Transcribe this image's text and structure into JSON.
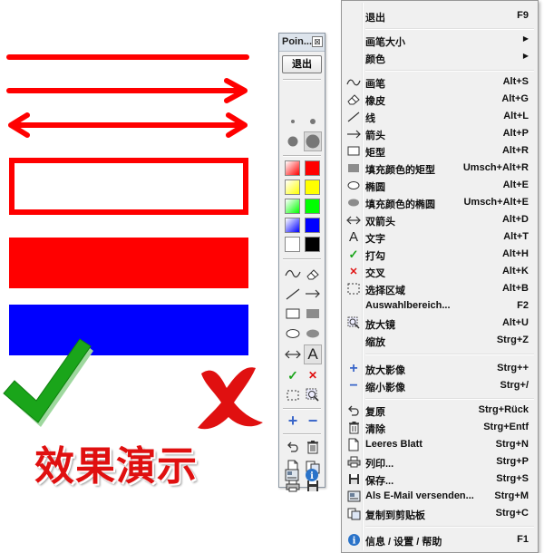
{
  "demo": {
    "title": "效果演示",
    "colors": {
      "red": "#ff0000",
      "blue": "#0000ff",
      "green": "#1aa51a",
      "cross": "#e01010"
    }
  },
  "toolbar": {
    "title": "Poin...",
    "close_glyph": "⊠",
    "exit_label": "退出",
    "text_tool_glyph": "A",
    "check_glyph": "✓",
    "cross_glyph": "✕",
    "plus_glyph": "+",
    "minus_glyph": "−",
    "info_glyph": "i",
    "colors": [
      "#ff0000",
      "#ffff00",
      "#00ff00",
      "#0000ff",
      "#000000",
      "#ffffff"
    ]
  },
  "menu": {
    "items": [
      {
        "label": "退出",
        "shortcut": "F9",
        "icon": "none"
      },
      {
        "label": "画笔大小",
        "shortcut": "",
        "icon": "none",
        "submenu": true
      },
      {
        "label": "颜色",
        "shortcut": "",
        "icon": "none",
        "submenu": true
      },
      {
        "label": "画笔",
        "shortcut": "Alt+S",
        "icon": "pen-icon"
      },
      {
        "label": "橡皮",
        "shortcut": "Alt+G",
        "icon": "eraser-icon"
      },
      {
        "label": "线",
        "shortcut": "Alt+L",
        "icon": "line-icon"
      },
      {
        "label": "箭头",
        "shortcut": "Alt+P",
        "icon": "arrow-icon"
      },
      {
        "label": "矩型",
        "shortcut": "Alt+R",
        "icon": "rectangle-icon"
      },
      {
        "label": "填充颜色的矩型",
        "shortcut": "Umsch+Alt+R",
        "icon": "filled-rectangle-icon"
      },
      {
        "label": "椭圆",
        "shortcut": "Alt+E",
        "icon": "ellipse-icon"
      },
      {
        "label": "填充颜色的椭圆",
        "shortcut": "Umsch+Alt+E",
        "icon": "filled-ellipse-icon"
      },
      {
        "label": "双箭头",
        "shortcut": "Alt+D",
        "icon": "double-arrow-icon"
      },
      {
        "label": "文字",
        "shortcut": "Alt+T",
        "icon": "text-icon"
      },
      {
        "label": "打勾",
        "shortcut": "Alt+H",
        "icon": "checkmark-icon"
      },
      {
        "label": "交叉",
        "shortcut": "Alt+K",
        "icon": "cross-icon"
      },
      {
        "label": "选择区域",
        "shortcut": "Alt+B",
        "icon": "selection-icon"
      },
      {
        "label": "Auswahlbereich...",
        "shortcut": "F2",
        "icon": "none"
      },
      {
        "label": "放大镜",
        "shortcut": "Alt+U",
        "icon": "magnifier-icon"
      },
      {
        "label": "缩放",
        "shortcut": "Strg+Z",
        "icon": "none"
      },
      {
        "label": "放大影像",
        "shortcut": "Strg++",
        "icon": "zoom-in-icon"
      },
      {
        "label": "缩小影像",
        "shortcut": "Strg+/",
        "icon": "zoom-out-icon"
      },
      {
        "label": "复原",
        "shortcut": "Strg+Rück",
        "icon": "undo-icon"
      },
      {
        "label": "清除",
        "shortcut": "Strg+Entf",
        "icon": "trash-icon"
      },
      {
        "label": "Leeres Blatt",
        "shortcut": "Strg+N",
        "icon": "blank-page-icon"
      },
      {
        "label": "列印...",
        "shortcut": "Strg+P",
        "icon": "printer-icon"
      },
      {
        "label": "保存...",
        "shortcut": "Strg+S",
        "icon": "save-icon"
      },
      {
        "label": "Als E-Mail versenden...",
        "shortcut": "Strg+M",
        "icon": "email-icon"
      },
      {
        "label": "复制到剪贴板",
        "shortcut": "Strg+C",
        "icon": "clipboard-icon"
      },
      {
        "label": "信息 / 设置 / 帮助",
        "shortcut": "F1",
        "icon": "info-icon"
      }
    ],
    "text_icon_glyph": "A",
    "check_glyph": "✓",
    "cross_glyph": "✕",
    "plus_glyph": "+",
    "minus_glyph": "−",
    "info_glyph": "i",
    "submenu_arrow": "▶"
  }
}
